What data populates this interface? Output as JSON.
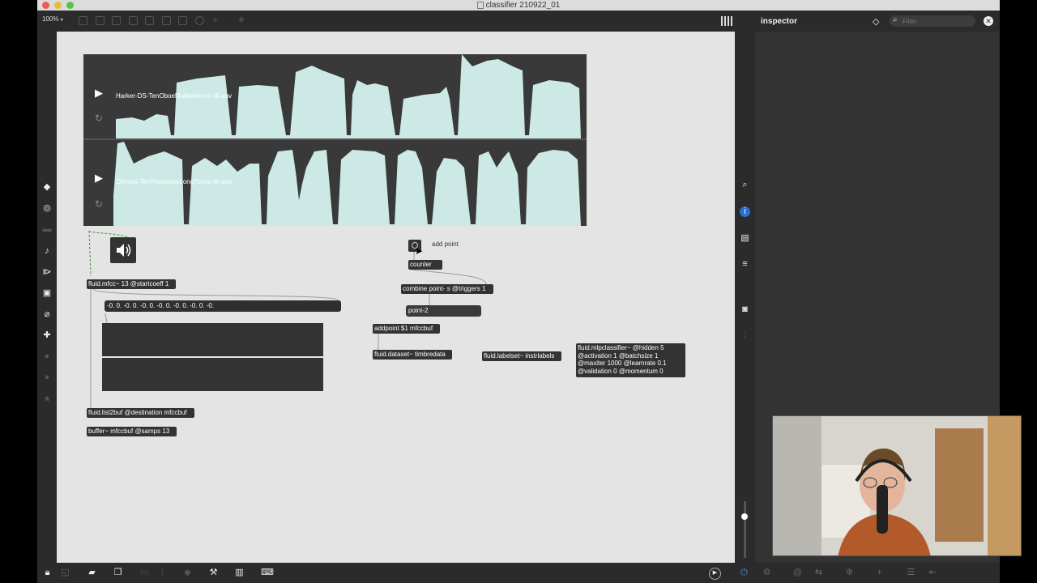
{
  "window": {
    "title": "classifier 210922_01"
  },
  "toolbar": {
    "zoom": "100%"
  },
  "inspector": {
    "title": "inspector",
    "filter_placeholder": "Filter"
  },
  "waveform": {
    "tracks": [
      {
        "filename": "Harker-DS-TenOboeMultiphonics-M.wav"
      },
      {
        "filename": "Olencki-TenTromboneLongTones-M.wav"
      }
    ]
  },
  "patch": {
    "add_point_comment": "add point",
    "counter": "counter",
    "combine": "combine point- s @triggers 1",
    "point_msg": "point-2",
    "addpoint": "addpoint $1 mfccbuf",
    "dataset": "fluid.dataset~ timbredata",
    "labelset": "fluid.labelset~ instrlabels",
    "mlp": "fluid.mlpclassifier~ @hidden 5\n@activation 1 @batchsize 1\n@maxiter 1000 @learnrate 0.1\n@validation 0 @momentum 0",
    "mfcc": "fluid.mfcc~ 13 @startcoeff 1",
    "mfcc_values": "-0. 0. -0. 0. -0. 0. -0. 0. -0. 0. -0. 0. -0.",
    "list2buf": "fluid.list2buf @destination mfccbuf",
    "buffer": "buffer~ mfccbuf @samps 13"
  },
  "colors": {
    "waveform_fill": "#cce9e6",
    "canvas_bg": "#e4e4e4",
    "object_bg": "#333333"
  }
}
